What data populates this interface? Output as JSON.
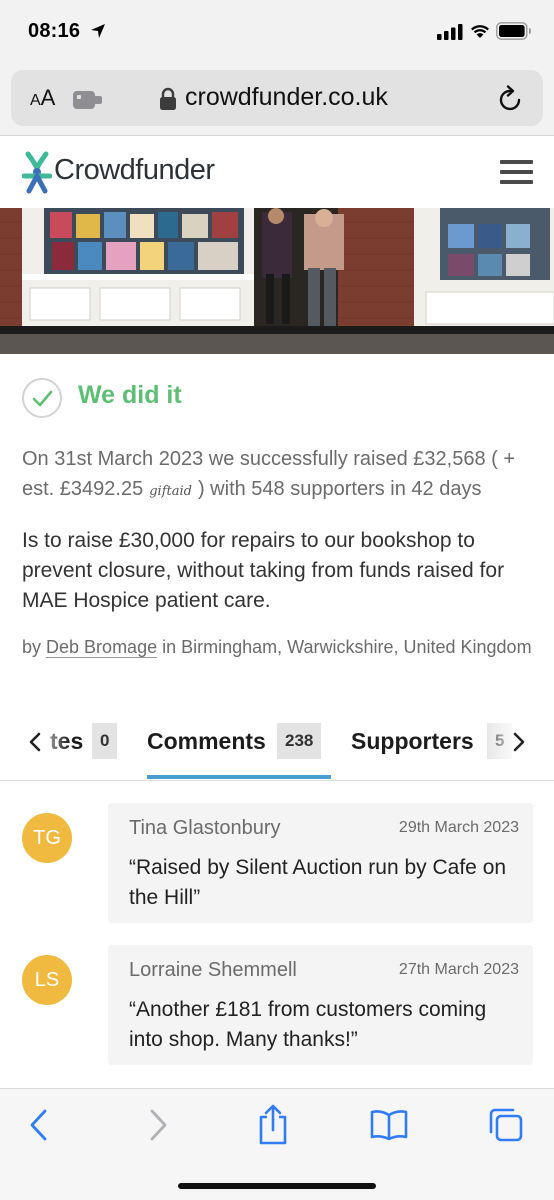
{
  "status_bar": {
    "time": "08:16"
  },
  "browser": {
    "aa_label_small": "A",
    "aa_label_large": "A",
    "url": "crowdfunder.co.uk"
  },
  "site": {
    "logo_text": "Crowdfunder"
  },
  "campaign": {
    "status": "We did it",
    "raised_prefix": "On 31st March 2023 we successfully raised £32,568 ( + est. £3492.25",
    "giftaid_label": "giftaid",
    "raised_suffix": ") with 548 supporters in 42 days",
    "aim": "Is to raise £30,000 for repairs to our bookshop to prevent closure, without taking from funds raised for MAE Hospice patient care.",
    "owner_prefix": "by",
    "owner_name": "Deb Bromage",
    "owner_location": "in Birmingham, Warwickshire, United Kingdom"
  },
  "tabs": {
    "items": [
      {
        "label": "tes",
        "count": "0"
      },
      {
        "label": "Comments",
        "count": "238",
        "active": true
      },
      {
        "label": "Supporters",
        "count": "5"
      }
    ]
  },
  "comments": [
    {
      "initials": "TG",
      "author": "Tina Glastonbury",
      "date": "29th March 2023",
      "text": "“Raised by Silent Auction run by Cafe on the Hill”"
    },
    {
      "initials": "LS",
      "author": "Lorraine Shemmell",
      "date": "27th March 2023",
      "text": "“Another £181 from customers coming into shop. Many thanks!”"
    }
  ],
  "colors": {
    "success_green": "#5cbf73",
    "tab_active_blue": "#4a9fd1",
    "avatar_yellow": "#f0b93f",
    "ios_blue": "#2f7cf6"
  },
  "icons": [
    "location-arrow-icon",
    "signal-icon",
    "wifi-icon",
    "battery-icon",
    "extension-icon",
    "lock-icon",
    "reload-icon",
    "crowdfunder-logo-icon",
    "hamburger-menu-icon",
    "check-icon",
    "chevron-left-icon",
    "chevron-right-icon",
    "back-icon",
    "forward-icon",
    "share-icon",
    "bookmarks-icon",
    "tabs-icon"
  ]
}
